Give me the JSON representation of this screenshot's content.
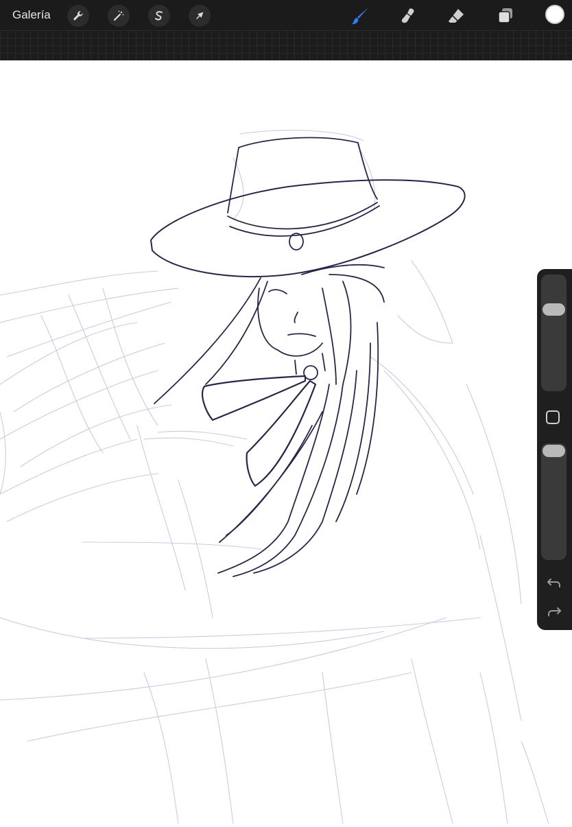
{
  "topbar": {
    "gallery_label": "Galería",
    "actions": [
      {
        "icon": "wrench-icon",
        "name": "actions-button"
      },
      {
        "icon": "magic-wand-icon",
        "name": "adjustments-button"
      },
      {
        "icon": "selection-s-icon",
        "name": "selection-button"
      },
      {
        "icon": "cursor-arrow-icon",
        "name": "transform-button"
      }
    ],
    "tools": [
      {
        "icon": "brush-icon",
        "name": "brush-tool",
        "active": true
      },
      {
        "icon": "smudge-icon",
        "name": "smudge-tool"
      },
      {
        "icon": "eraser-icon",
        "name": "eraser-tool"
      },
      {
        "icon": "layers-icon",
        "name": "layers-button"
      }
    ],
    "current_color": "#ffffff",
    "accent_color": "#2f7cf6"
  },
  "canvas": {
    "background": "#ffffff",
    "sketch_color": "#cfc8e0",
    "lineart_color": "#2c2347"
  },
  "sidebar": {
    "brush_size_level": 0.73,
    "opacity_level": 1.0,
    "undo_icon": "undo-arrow-icon",
    "redo_icon": "redo-arrow-icon"
  }
}
